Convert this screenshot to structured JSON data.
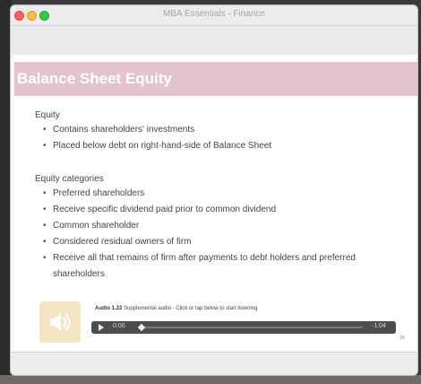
{
  "window": {
    "title": "MBA Essentials - Finance"
  },
  "slide": {
    "title": "Balance Sheet Equity",
    "section1": {
      "heading": "Equity",
      "bullets": [
        "Contains shareholders' investments",
        "Placed below debt on right-hand-side of Balance Sheet"
      ]
    },
    "section2": {
      "heading": "Equity categories",
      "bullets": [
        "Preferred shareholders",
        "Receive specific dividend paid prior to common dividend",
        "Common shareholder",
        "Considered residual owners of firm",
        "Receive all that remains of firm after payments to debt holders and preferred",
        "shareholders"
      ]
    },
    "audio": {
      "label": "Audio 1.22",
      "caption": "Supplemental audio - Click or tap below to start listening",
      "current_time": "0:00",
      "remaining_time": "-1:04",
      "progress": 0.0
    },
    "page_number": "29"
  }
}
